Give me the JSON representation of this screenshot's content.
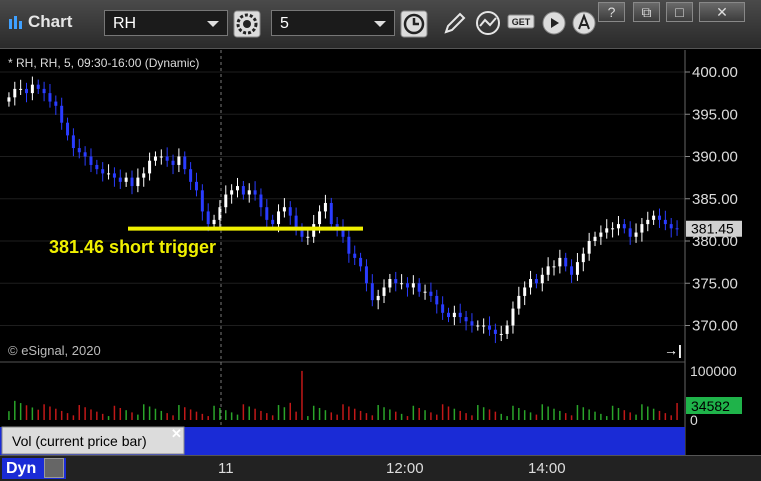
{
  "window": {
    "title": "Chart",
    "symbol": "RH",
    "interval": "5",
    "controls": {
      "help": "?",
      "restore": "⧉",
      "maximize": "□",
      "close": "✕"
    }
  },
  "toolbar_icons": [
    "settings-icon",
    "clock-icon",
    "pencil-icon",
    "study-icon",
    "get-icon",
    "play-icon",
    "alert-icon"
  ],
  "chart": {
    "header": "* RH, RH, 5, 09:30-16:00 (Dynamic)",
    "copyright": "© eSignal, 2020",
    "annotation": "381.46 short trigger",
    "last_price_label": "381.45",
    "volume_header": "Vol (current price bar)",
    "volume_last_label": "34582",
    "status_mode": "Dyn",
    "colors": {
      "up": "#ffffff",
      "down": "#2a3cff",
      "trigger": "#f0f000",
      "vol_up": "#2aa52a",
      "vol_down": "#c21818",
      "status_blue": "#1a2bd6"
    }
  },
  "chart_data": [
    {
      "type": "candlestick",
      "title": "* RH, RH, 5, 09:30-16:00 (Dynamic)",
      "ylim": [
        366,
        402
      ],
      "yticks": [
        "400.00",
        "395.00",
        "390.00",
        "385.00",
        "380.00",
        "375.00",
        "370.00"
      ],
      "xticks": [
        "11",
        "12:00",
        "14:00"
      ],
      "last_price": 381.45,
      "horizontal_lines": [
        {
          "value": 381.46,
          "label": "381.46 short trigger"
        }
      ],
      "closes": [
        397.0,
        398.0,
        398.0,
        397.5,
        398.5,
        398.0,
        397.5,
        396.5,
        396.0,
        394.0,
        392.5,
        391.0,
        390.5,
        390.0,
        389.0,
        388.5,
        388.0,
        388.0,
        387.5,
        387.0,
        387.5,
        386.5,
        387.5,
        388.0,
        389.5,
        390.0,
        390.0,
        389.5,
        389.0,
        390.0,
        388.5,
        387.0,
        386.0,
        383.5,
        382.0,
        382.5,
        384.0,
        385.5,
        386.0,
        386.5,
        385.5,
        386.0,
        385.5,
        384.0,
        382.5,
        382.0,
        383.5,
        384.0,
        383.0,
        381.5,
        380.5,
        380.5,
        382.0,
        383.5,
        384.5,
        382.0,
        381.5,
        380.5,
        378.5,
        378.0,
        377.0,
        375.0,
        373.0,
        373.5,
        374.5,
        375.5,
        375.0,
        375.0,
        374.5,
        375.0,
        374.0,
        374.0,
        373.5,
        372.5,
        371.5,
        371.0,
        371.5,
        371.0,
        370.5,
        370.0,
        370.0,
        370.0,
        369.5,
        369.0,
        369.0,
        370.0,
        372.0,
        373.5,
        374.5,
        375.5,
        375.0,
        376.0,
        377.0,
        377.0,
        378.0,
        377.0,
        376.0,
        377.5,
        378.5,
        380.0,
        380.5,
        381.0,
        381.5,
        381.5,
        382.0,
        381.5,
        380.5,
        381.0,
        382.0,
        382.5,
        383.0,
        382.5,
        382.0,
        381.5,
        381.45
      ],
      "panels": [
        {
          "name": "Vol (current price bar)",
          "ylim": [
            0,
            110000
          ],
          "yticks": [
            "100000",
            "0"
          ],
          "last_value": 34582
        }
      ]
    }
  ]
}
